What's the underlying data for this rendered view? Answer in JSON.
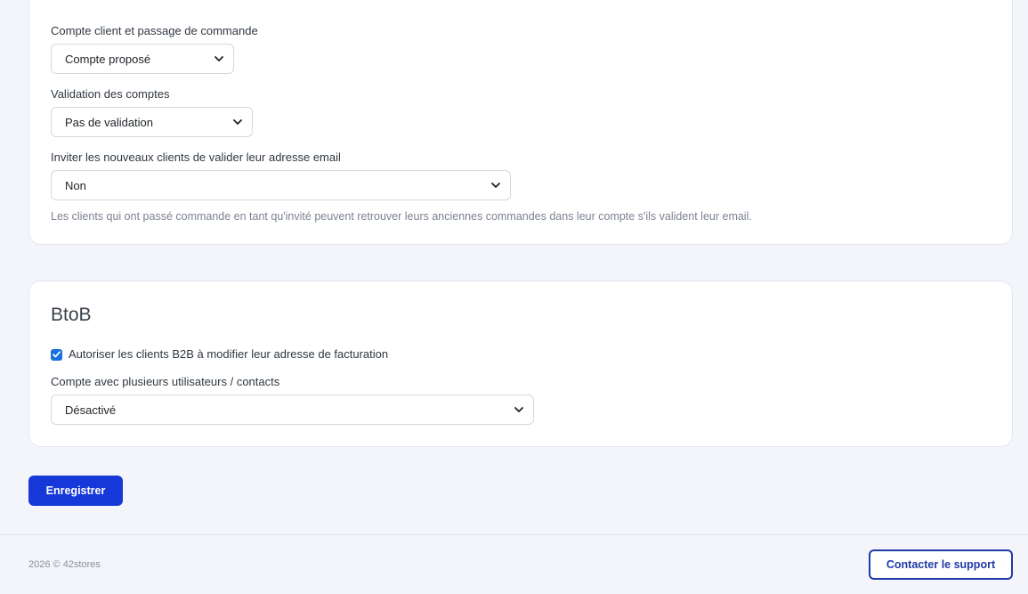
{
  "accounts": {
    "customer_account": {
      "label": "Compte client et passage de commande",
      "selected": "Compte proposé"
    },
    "account_validation": {
      "label": "Validation des comptes",
      "selected": "Pas de validation"
    },
    "email_validation": {
      "label": "Inviter les nouveaux clients de valider leur adresse email",
      "selected": "Non",
      "help": "Les clients qui ont passé commande en tant qu'invité peuvent retrouver leurs anciennes commandes dans leur compte s'ils valident leur email."
    }
  },
  "btob": {
    "title": "BtoB",
    "allow_billing_edit": {
      "label": "Autoriser les clients B2B à modifier leur adresse de facturation",
      "checked": true
    },
    "multi_user": {
      "label": "Compte avec plusieurs utilisateurs / contacts",
      "selected": "Désactivé"
    }
  },
  "actions": {
    "save_label": "Enregistrer"
  },
  "footer": {
    "copyright": "2026 © 42stores",
    "support_label": "Contacter le support"
  },
  "colors": {
    "primary": "#1638d8",
    "outline": "#1f3aa8",
    "checkbox": "#1a6fe0",
    "background": "#f3f5fb"
  }
}
